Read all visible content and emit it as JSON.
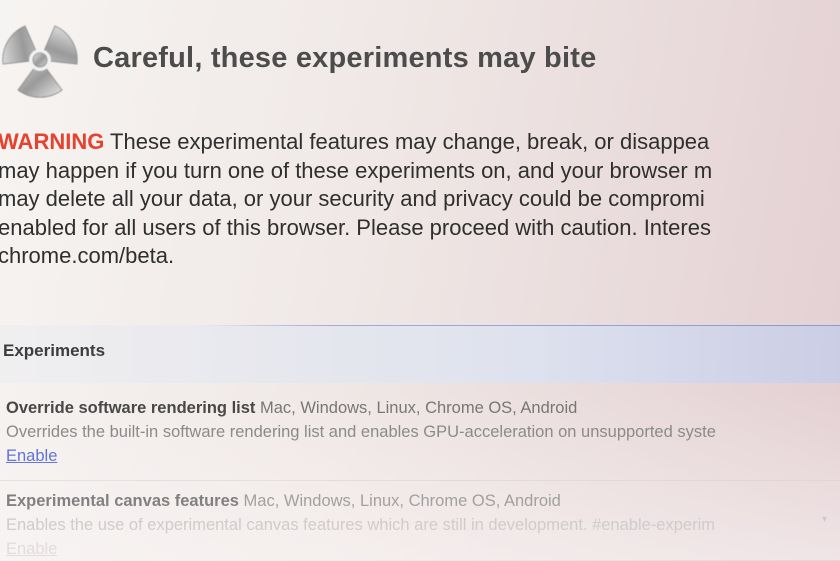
{
  "header": {
    "title": "Careful, these experiments may bite",
    "logo_icon": "radiation-hazard-icon"
  },
  "warning": {
    "tag": "WARNING",
    "line1_rest": " These experimental features may change, break, or disappea",
    "line2": "may happen if you turn one of these experiments on, and your browser m",
    "line3": "may delete all your data, or your security and privacy could be compromi",
    "line4": "enabled for all users of this browser. Please proceed with caution. Interes",
    "line5": "chrome.com/beta."
  },
  "section": {
    "title": "Experiments"
  },
  "experiments": [
    {
      "name": "Override software rendering list",
      "platforms": " Mac, Windows, Linux, Chrome OS, Android",
      "description": "Overrides the built-in software rendering list and enables GPU-acceleration on unsupported syste",
      "action": "Enable"
    },
    {
      "name": "Experimental canvas features",
      "platforms": " Mac, Windows, Linux, Chrome OS, Android",
      "description": "Enables the use of experimental canvas features which are still in development. #enable-experim",
      "action": "Enable"
    }
  ],
  "colors": {
    "warning_red": "#e8412e",
    "link_blue": "#3a4fd1",
    "section_bar_accent": "#c6cde8"
  }
}
